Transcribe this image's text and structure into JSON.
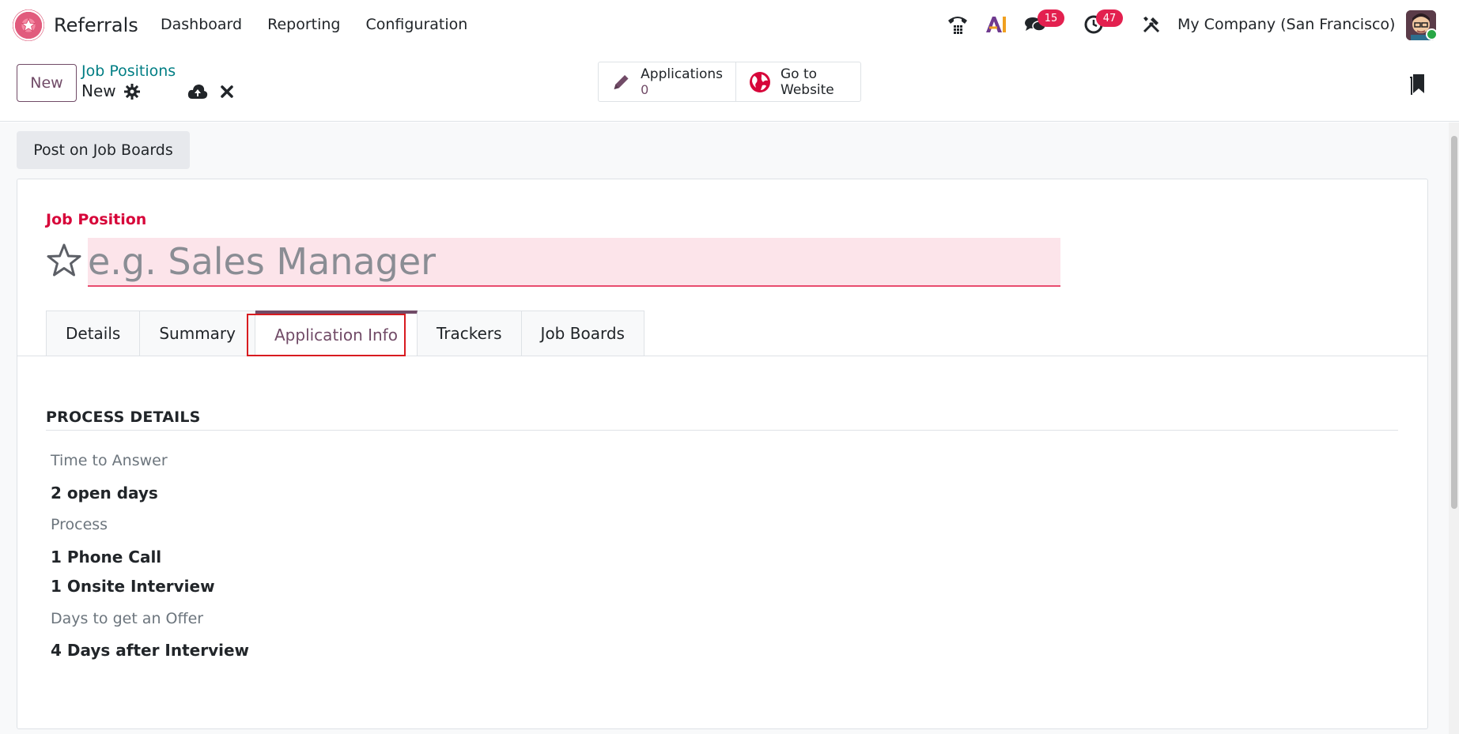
{
  "app": {
    "name": "Referrals"
  },
  "nav": {
    "items": [
      "Dashboard",
      "Reporting",
      "Configuration"
    ]
  },
  "systray": {
    "messages_count": "15",
    "activities_count": "47",
    "company": "My Company (San Francisco)"
  },
  "control": {
    "new_label": "New",
    "breadcrumb": "Job Positions",
    "record": "New",
    "applications_label": "Applications",
    "applications_value": "0",
    "website_label": "Go to Website"
  },
  "form": {
    "post_button": "Post on Job Boards",
    "job_label": "Job Position",
    "job_placeholder": "e.g. Sales Manager",
    "tabs": [
      "Details",
      "Summary",
      "Application Info",
      "Trackers",
      "Job Boards"
    ],
    "section_title": "PROCESS DETAILS",
    "time_to_answer_label": "Time to Answer",
    "time_to_answer_value": "2 open days",
    "process_label": "Process",
    "process_values": [
      "1 Phone Call",
      "1 Onsite Interview"
    ],
    "offer_label": "Days to get an Offer",
    "offer_value": "4 Days after Interview"
  },
  "colors": {
    "brand": "#714b67",
    "required": "#d7063a",
    "badge": "#e3204f",
    "link": "#017e84"
  }
}
